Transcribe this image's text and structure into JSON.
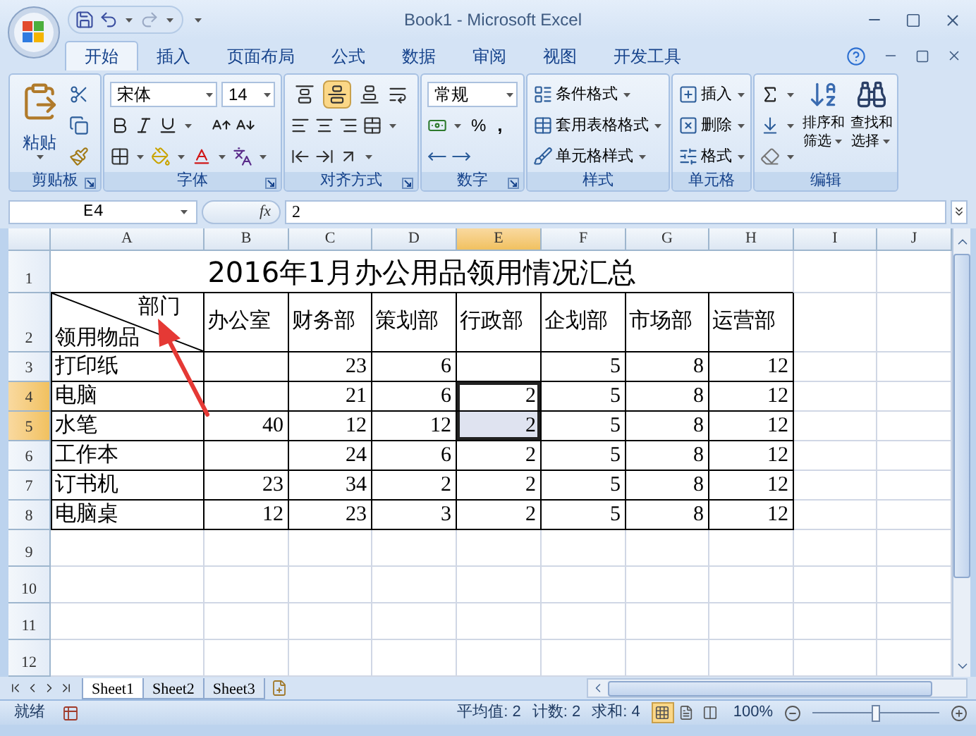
{
  "window": {
    "title": "Book1 - Microsoft Excel"
  },
  "tabs": [
    {
      "label": "开始",
      "selected": true
    },
    {
      "label": "插入",
      "selected": false
    },
    {
      "label": "页面布局",
      "selected": false
    },
    {
      "label": "公式",
      "selected": false
    },
    {
      "label": "数据",
      "selected": false
    },
    {
      "label": "审阅",
      "selected": false
    },
    {
      "label": "视图",
      "selected": false
    },
    {
      "label": "开发工具",
      "selected": false
    }
  ],
  "ribbon": {
    "clipboard": {
      "paste": "粘贴",
      "label": "剪贴板"
    },
    "font": {
      "name": "宋体",
      "size": "14",
      "label": "字体"
    },
    "alignment": {
      "vertical_align": [
        {
          "selected": false
        },
        {
          "selected": true
        },
        {
          "selected": false
        }
      ],
      "label": "对齐方式"
    },
    "number": {
      "format": "常规",
      "percent": "%",
      "comma": ",",
      "label": "数字"
    },
    "styles": {
      "items": [
        "条件格式",
        "套用表格格式",
        "单元格样式"
      ],
      "label": "样式"
    },
    "cells": {
      "items": [
        "插入",
        "删除",
        "格式"
      ],
      "label": "单元格"
    },
    "editing": {
      "sort": [
        "排序和",
        "筛选"
      ],
      "find": [
        "查找和",
        "选择"
      ],
      "label": "编辑"
    }
  },
  "formula_bar": {
    "name_box": "E4",
    "function_label": "fx",
    "value": "2"
  },
  "sheet": {
    "columns": [
      {
        "label": "A",
        "selected": false
      },
      {
        "label": "B",
        "selected": false
      },
      {
        "label": "C",
        "selected": false
      },
      {
        "label": "D",
        "selected": false
      },
      {
        "label": "E",
        "selected": true
      },
      {
        "label": "F",
        "selected": false
      },
      {
        "label": "G",
        "selected": false
      },
      {
        "label": "H",
        "selected": false
      },
      {
        "label": "I",
        "selected": false
      },
      {
        "label": "J",
        "selected": false
      }
    ],
    "rows": [
      {
        "label": "1",
        "selected": false
      },
      {
        "label": "2",
        "selected": false
      },
      {
        "label": "3",
        "selected": false
      },
      {
        "label": "4",
        "selected": true
      },
      {
        "label": "5",
        "selected": true
      },
      {
        "label": "6",
        "selected": false
      },
      {
        "label": "7",
        "selected": false
      },
      {
        "label": "8",
        "selected": false
      },
      {
        "label": "9",
        "selected": false
      },
      {
        "label": "10",
        "selected": false
      },
      {
        "label": "11",
        "selected": false
      },
      {
        "label": "12",
        "selected": false
      }
    ],
    "title": "2016年1月办公用品领用情况汇总",
    "corner_top": "部门",
    "corner_bottom": "领用物品",
    "departments": [
      "办公室",
      "财务部",
      "策划部",
      "行政部",
      "企划部",
      "市场部",
      "运营部"
    ],
    "items": [
      {
        "name": "打印纸",
        "values": [
          {
            "blank": true
          },
          {
            "text": "23"
          },
          {
            "text": "6"
          },
          {
            "blank": true
          },
          {
            "text": "5"
          },
          {
            "text": "8"
          },
          {
            "text": "12"
          }
        ]
      },
      {
        "name": "电脑",
        "values": [
          {
            "blank": true
          },
          {
            "text": "21"
          },
          {
            "text": "6"
          },
          {
            "text": "2"
          },
          {
            "text": "5"
          },
          {
            "text": "8"
          },
          {
            "text": "12"
          }
        ]
      },
      {
        "name": "水笔",
        "values": [
          {
            "text": "40"
          },
          {
            "text": "12"
          },
          {
            "text": "12"
          },
          {
            "text": "2"
          },
          {
            "text": "5"
          },
          {
            "text": "8"
          },
          {
            "text": "12"
          }
        ]
      },
      {
        "name": "工作本",
        "values": [
          {
            "blank": true
          },
          {
            "text": "24"
          },
          {
            "text": "6"
          },
          {
            "text": "2"
          },
          {
            "text": "5"
          },
          {
            "text": "8"
          },
          {
            "text": "12"
          }
        ]
      },
      {
        "name": "订书机",
        "values": [
          {
            "text": "23"
          },
          {
            "text": "34"
          },
          {
            "text": "2"
          },
          {
            "text": "2"
          },
          {
            "text": "5"
          },
          {
            "text": "8"
          },
          {
            "text": "12"
          }
        ]
      },
      {
        "name": "电脑桌",
        "values": [
          {
            "text": "12"
          },
          {
            "text": "23"
          },
          {
            "text": "3"
          },
          {
            "text": "2"
          },
          {
            "text": "5"
          },
          {
            "text": "8"
          },
          {
            "text": "12"
          }
        ]
      }
    ]
  },
  "sheet_tabs": [
    {
      "label": "Sheet1",
      "selected": true
    },
    {
      "label": "Sheet2",
      "selected": false
    },
    {
      "label": "Sheet3",
      "selected": false
    }
  ],
  "status_bar": {
    "mode": "就绪",
    "average": "平均值: 2",
    "count": "计数: 2",
    "sum": "求和: 4",
    "views": [
      {
        "selected": true
      },
      {
        "selected": false
      },
      {
        "selected": false
      }
    ],
    "zoom": "100%",
    "zoom_slider": {
      "level": 0.5
    }
  }
}
